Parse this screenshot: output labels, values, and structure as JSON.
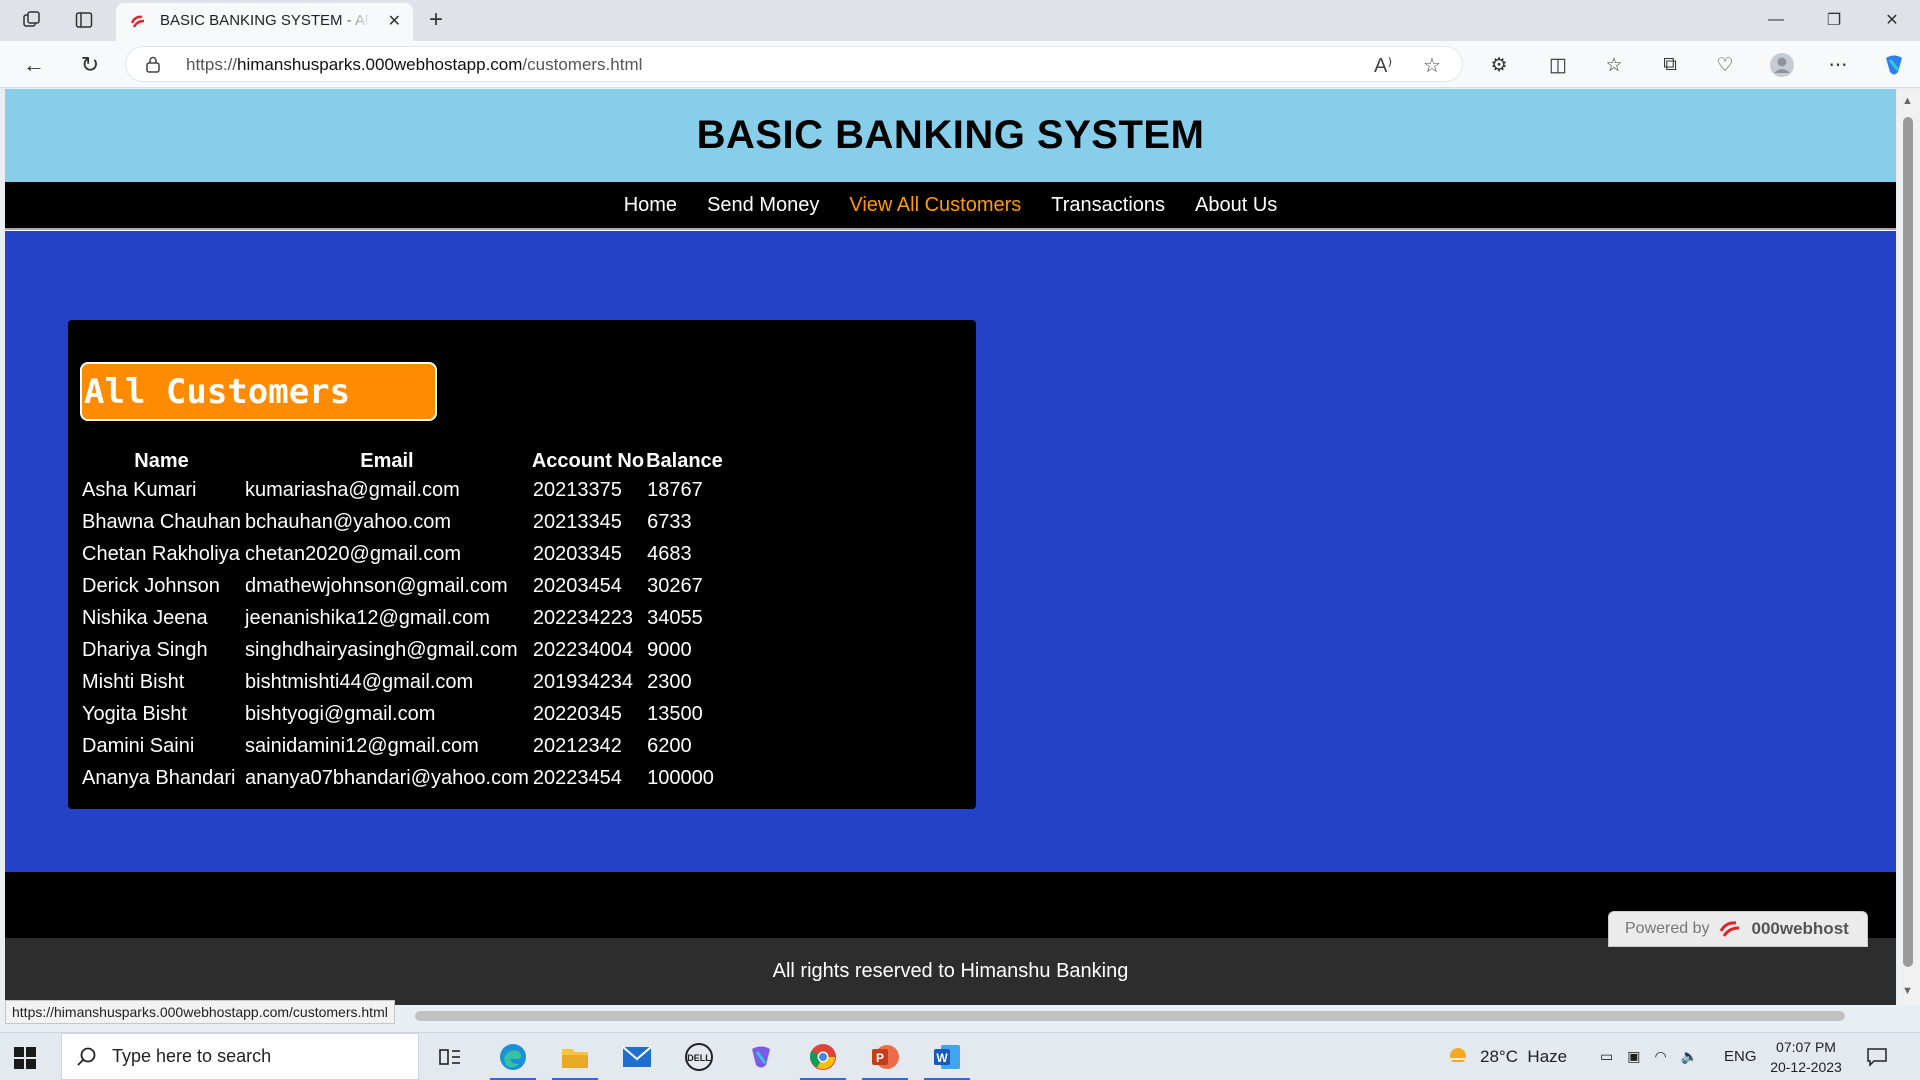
{
  "browser": {
    "tab_title": "BASIC BANKING SYSTEM - All Customers",
    "url_prefix": "https://",
    "url_host": "himanshusparks.000webhostapp.com",
    "url_path": "/customers.html",
    "status_url": "https://himanshusparks.000webhostapp.com/customers.html"
  },
  "site": {
    "title": "BASIC BANKING SYSTEM",
    "nav": [
      {
        "label": "Home"
      },
      {
        "label": "Send Money"
      },
      {
        "label": "View All Customers"
      },
      {
        "label": "Transactions"
      },
      {
        "label": "About Us"
      }
    ],
    "active_nav": "View All Customers",
    "heading": "All Customers",
    "columns": [
      "Name",
      "Email",
      "Account No",
      "Balance"
    ],
    "customers": [
      {
        "name": "Asha Kumari",
        "email": "kumariasha@gmail.com",
        "account": "20213375",
        "balance": "18767"
      },
      {
        "name": "Bhawna Chauhan",
        "email": "bchauhan@yahoo.com",
        "account": "20213345",
        "balance": "6733"
      },
      {
        "name": "Chetan Rakholiya",
        "email": "chetan2020@gmail.com",
        "account": "20203345",
        "balance": "4683"
      },
      {
        "name": "Derick Johnson",
        "email": "dmathewjohnson@gmail.com",
        "account": "20203454",
        "balance": "30267"
      },
      {
        "name": "Nishika Jeena",
        "email": "jeenanishika12@gmail.com",
        "account": "202234223",
        "balance": "34055"
      },
      {
        "name": "Dhariya Singh",
        "email": "singhdhairyasingh@gmail.com",
        "account": "202234004",
        "balance": "9000"
      },
      {
        "name": "Mishti Bisht",
        "email": "bishtmishti44@gmail.com",
        "account": "201934234",
        "balance": "2300"
      },
      {
        "name": "Yogita Bisht",
        "email": "bishtyogi@gmail.com",
        "account": "20220345",
        "balance": "13500"
      },
      {
        "name": "Damini Saini",
        "email": "sainidamini12@gmail.com",
        "account": "20212342",
        "balance": "6200"
      },
      {
        "name": "Ananya Bhandari",
        "email": "ananya07bhandari@yahoo.com",
        "account": "20223454",
        "balance": "100000"
      }
    ],
    "footer": "All rights reserved to Himanshu Banking",
    "powered_by": "Powered by",
    "powered_brand": "000webhost"
  },
  "taskbar": {
    "search_placeholder": "Type here to search",
    "weather": "28°C  Haze",
    "language": "ENG",
    "time": "07:07 PM",
    "date": "20-12-2023"
  },
  "colors": {
    "header_bg": "#87ceeb",
    "main_bg": "#2342c8",
    "accent": "#ff8c00",
    "active_link": "#ff9a00"
  }
}
